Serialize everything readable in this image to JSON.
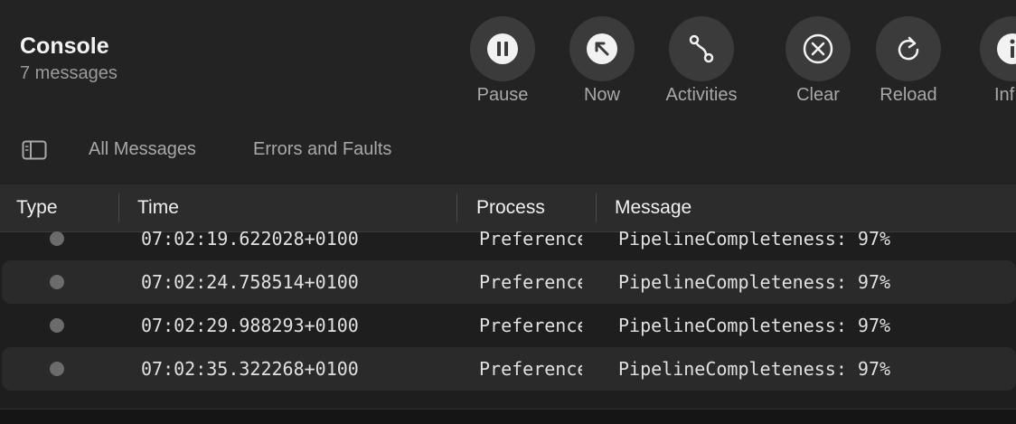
{
  "app": {
    "title": "Console",
    "subtitle": "7 messages"
  },
  "toolbar": {
    "buttons": [
      {
        "label": "Pause",
        "icon": "pause-icon"
      },
      {
        "label": "Now",
        "icon": "arrow-up-left-icon"
      },
      {
        "label": "Activities",
        "icon": "activities-icon"
      },
      {
        "label": "Clear",
        "icon": "clear-x-icon"
      },
      {
        "label": "Reload",
        "icon": "reload-icon"
      },
      {
        "label": "Inf",
        "icon": "info-icon"
      }
    ]
  },
  "filters": {
    "all": "All Messages",
    "errors": "Errors and Faults"
  },
  "table": {
    "columns": [
      "Type",
      "Time",
      "Process",
      "Message"
    ],
    "rows": [
      {
        "time": "07:02:19.622028+0100",
        "process": "Preferences",
        "message": "PipelineCompleteness: 97%"
      },
      {
        "time": "07:02:24.758514+0100",
        "process": "Preferences",
        "message": "PipelineCompleteness: 97%"
      },
      {
        "time": "07:02:29.988293+0100",
        "process": "Preferences",
        "message": "PipelineCompleteness: 97%"
      },
      {
        "time": "07:02:35.322268+0100",
        "process": "Preferences",
        "message": "PipelineCompleteness: 97%"
      }
    ]
  },
  "colors": {
    "background": "#1e1e1e",
    "button_bg": "#3b3b3b",
    "dot": "#6b6b6b"
  }
}
